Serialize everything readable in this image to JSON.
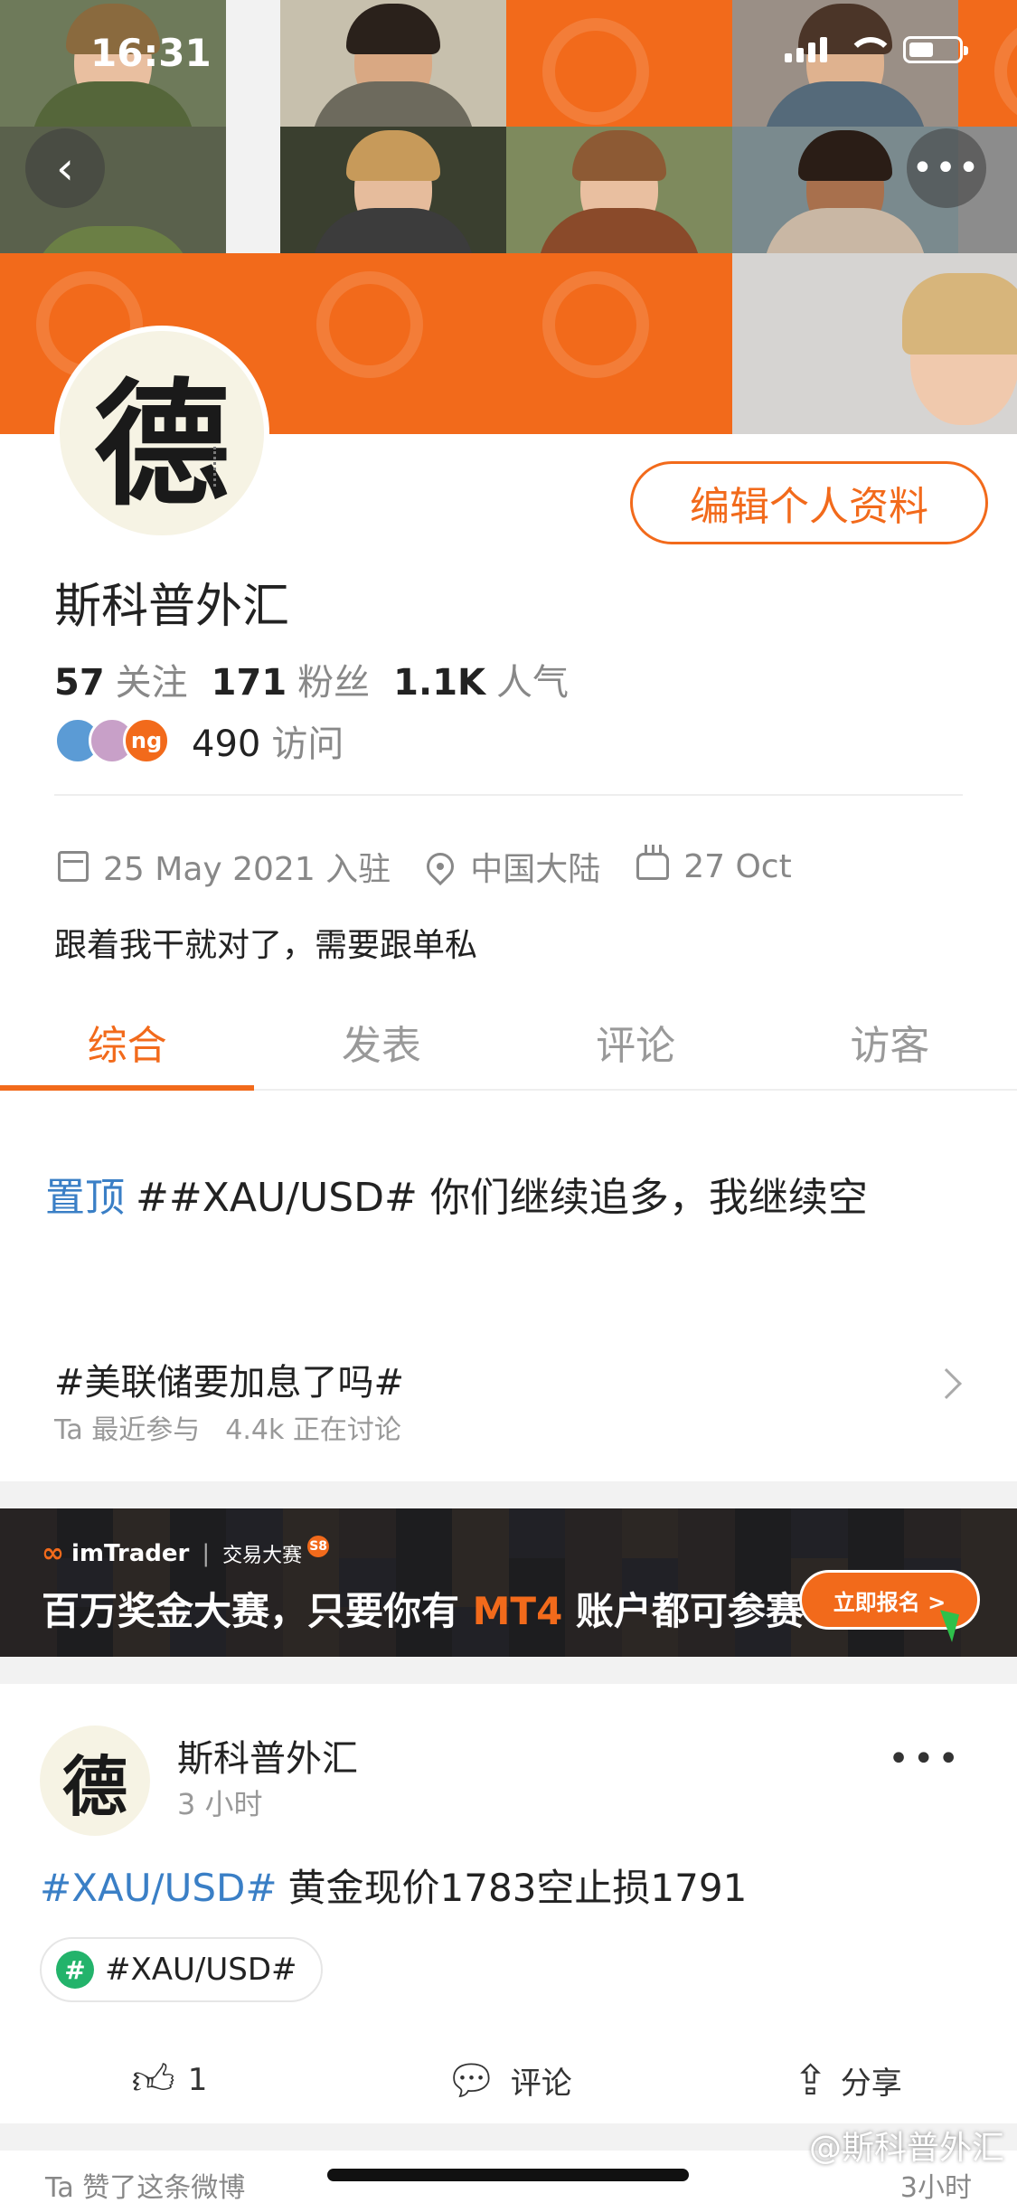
{
  "status_bar": {
    "time": "16:31"
  },
  "profile": {
    "avatar_glyph": "德",
    "name": "斯科普外汇",
    "edit_label": "编辑个人资料",
    "following_count": "57",
    "following_label": "关注",
    "followers_count": "171",
    "followers_label": "粉丝",
    "popularity_count": "1.1K",
    "popularity_label": "人气",
    "visitor_badge": "ng",
    "visits_count": "490",
    "visits_label": "访问",
    "joined": "25 May 2021 入驻",
    "location": "中国大陆",
    "birthday": "27 Oct",
    "bio": "跟着我干就对了，需要跟单私"
  },
  "tabs": [
    {
      "label": "综合"
    },
    {
      "label": "发表"
    },
    {
      "label": "评论"
    },
    {
      "label": "访客"
    }
  ],
  "pinned": {
    "tag": "置顶",
    "text": "##XAU/USD# 你们继续追多，我继续空"
  },
  "topic": {
    "title": "#美联储要加息了吗#",
    "recent": "Ta 最近参与",
    "discussing": "4.4k 正在讨论"
  },
  "ad": {
    "brand": "imTrader",
    "brand_sub": "交易大赛",
    "badge": "S8",
    "headline_a": "百万奖金大赛，只要你有 ",
    "headline_hl": "MT4",
    "headline_b": " 账户都可参赛",
    "cta": "立即报名 >"
  },
  "post": {
    "avatar_glyph": "德",
    "author": "斯科普外汇",
    "time": "3 小时",
    "hashtag": "#XAU/USD#",
    "content": "黄金现价1783空止损1791",
    "chip_hash": "#",
    "chip_label": "#XAU/USD#",
    "like_count": "1",
    "comment_label": "评论",
    "share_label": "分享"
  },
  "next_item": {
    "left": "Ta 赞了这条微博",
    "right": "3小时"
  },
  "watermark": "@斯科普外汇",
  "colors": {
    "accent": "#f26a1b",
    "link": "#3a7fc6",
    "topic_green": "#23b36b"
  }
}
